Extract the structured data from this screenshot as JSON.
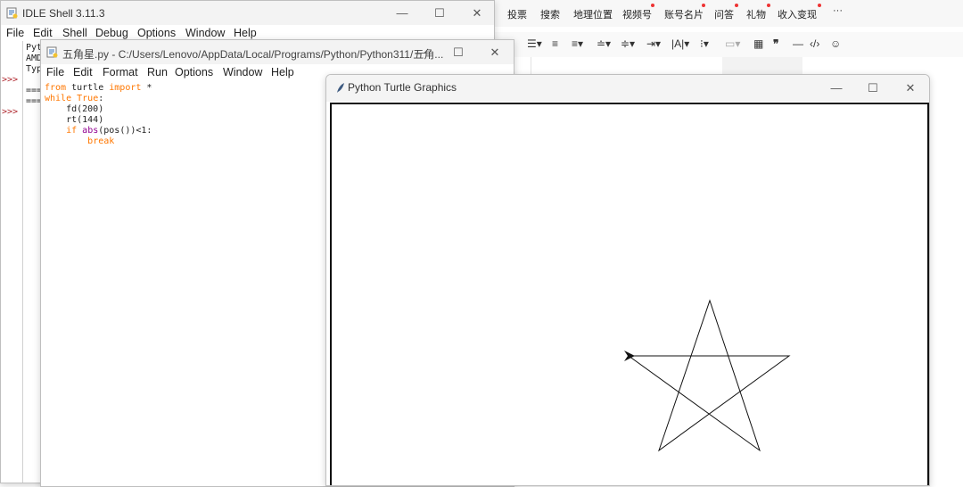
{
  "editor_toolbar": {
    "items": [
      "投票",
      "搜索",
      "地理位置",
      "视频号",
      "账号名片",
      "问答",
      "礼物",
      "收入变现",
      "···"
    ],
    "format_icons": [
      "list-icon",
      "align-left-icon",
      "align-center-icon",
      "align-right-icon",
      "line-height-icon",
      "indent-icon",
      "text-direction-icon",
      "bullet-list-icon",
      "divider-icon",
      "table-icon",
      "quote-icon",
      "hr-icon",
      "code-icon",
      "emoji-icon"
    ]
  },
  "shell_window": {
    "title": "IDLE Shell 3.11.3",
    "menu": [
      "File",
      "Edit",
      "Shell",
      "Debug",
      "Options",
      "Window",
      "Help"
    ],
    "visible_lines": [
      "Pyt",
      "AMD",
      "Typ",
      "===",
      "==="
    ],
    "prompts": [
      ">>>",
      ">>>"
    ]
  },
  "editor_window": {
    "title": "五角星.py - C:/Users/Lenovo/AppData/Local/Programs/Python/Python311/五角...",
    "menu": [
      "File",
      "Edit",
      "Format",
      "Run",
      "Options",
      "Window",
      "Help"
    ],
    "code": {
      "l1_kw1": "from",
      "l1_mid": " turtle ",
      "l1_kw2": "import",
      "l1_end": " *",
      "l2_kw": "while",
      "l2_sp": " ",
      "l2_val": "True",
      "l2_end": ":",
      "l3": "    fd(200)",
      "l4": "    rt(144)",
      "l5_ind": "    ",
      "l5_kw": "if",
      "l5_sp": " ",
      "l5_bi": "abs",
      "l5_end": "(pos())<1:",
      "l6_ind": "        ",
      "l6_kw": "break"
    }
  },
  "turtle_window": {
    "title": "Python Turtle Graphics"
  },
  "window_controls": {
    "minimize": "—",
    "maximize": "☐",
    "close": "✕"
  },
  "colors": {
    "keyword": "#ff7700",
    "builtin": "#900090",
    "prompt": "#b0282f",
    "notification_dot": "#e33333"
  }
}
